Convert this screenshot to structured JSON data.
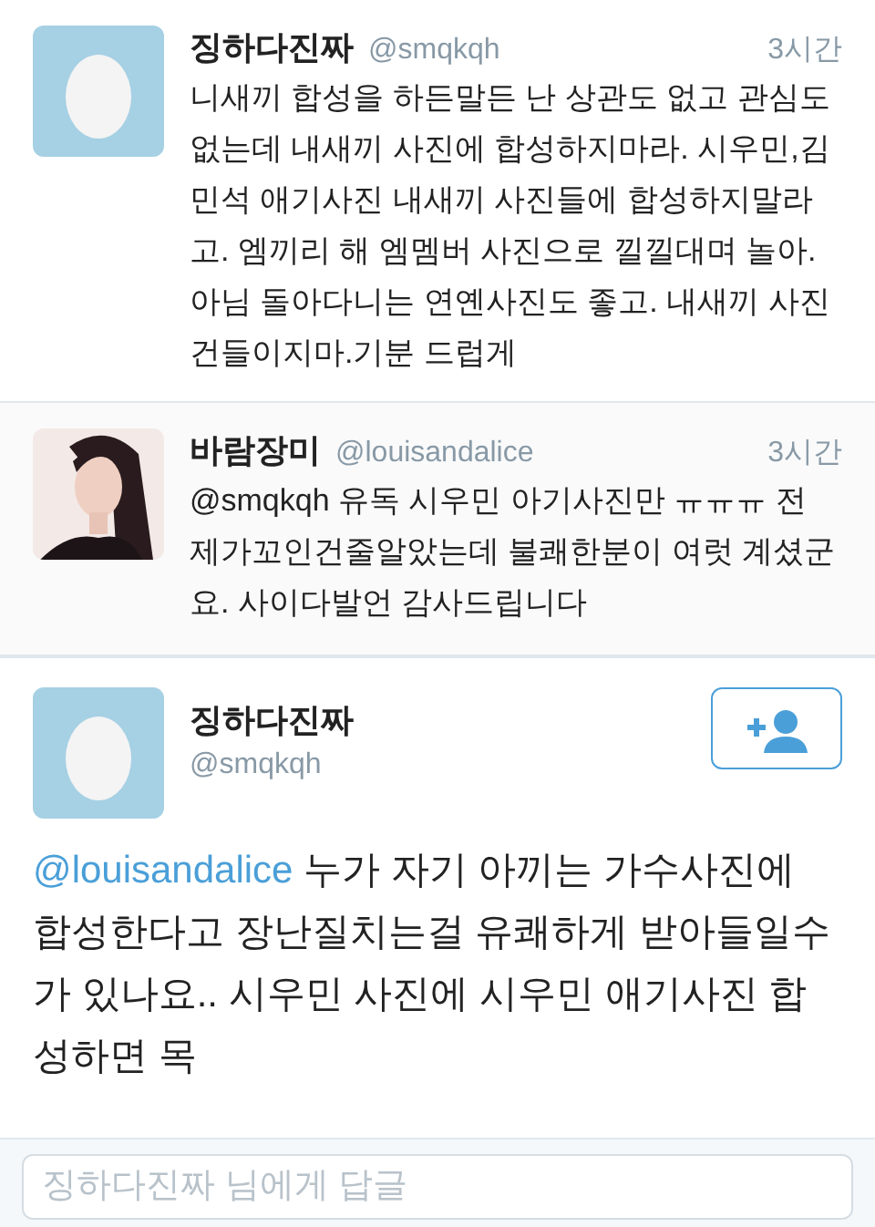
{
  "replies": [
    {
      "kind": "egg",
      "name": "징하다진짜",
      "handle": "@smqkqh",
      "time": "3시간",
      "text": "니새끼 합성을 하든말든 난 상관도 없고 관심도 없는데 내새끼 사진에 합성하지마라. 시우민,김민석 애기사진 내새끼 사진들에 합성하지말라고. 엠끼리 해 엠멤버 사진으로 낄낄대며 놀아. 아님 돌아다니는 연옌사진도 좋고. 내새끼 사진 건들이지마.기분 드럽게"
    },
    {
      "kind": "picture",
      "name": "바람장미",
      "handle": "@louisandalice",
      "time": "3시간",
      "text": "@smqkqh 유독 시우민 아기사진만 ㅠㅠㅠ 전 제가꼬인건줄알았는데 불쾌한분이 여럿 계셨군요. 사이다발언 감사드립니다"
    }
  ],
  "main_tweet": {
    "name": "징하다진짜",
    "handle": "@smqkqh",
    "mention": "@louisandalice",
    "text": "누가 자기 아끼는 가수사진에 합성한다고 장난질치는걸 유쾌하게 받아들일수가 있나요.. 시우민 사진에 시우민 애기사진 합성하면 목"
  },
  "reply_field": {
    "placeholder": "징하다진짜 님에게 답글"
  }
}
